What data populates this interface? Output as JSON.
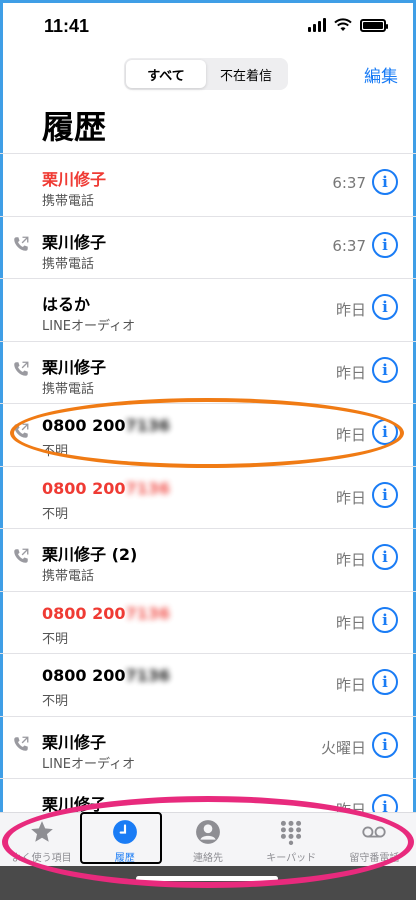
{
  "status_bar": {
    "time": "11:41"
  },
  "segmented": {
    "all": "すべて",
    "missed": "不在着信"
  },
  "header": {
    "edit": "編集",
    "title": "履歴"
  },
  "calls": [
    {
      "name": "栗川修子",
      "name_hidden": "",
      "subtitle": "携帯電話",
      "time": "6:37",
      "missed": true,
      "outgoing": false
    },
    {
      "name": "栗川修子",
      "name_hidden": "",
      "subtitle": "携帯電話",
      "time": "6:37",
      "missed": false,
      "outgoing": true
    },
    {
      "name": "はるか",
      "name_hidden": "",
      "subtitle": "LINEオーディオ",
      "time": "昨日",
      "missed": false,
      "outgoing": false
    },
    {
      "name": "栗川修子",
      "name_hidden": "",
      "subtitle": "携帯電話",
      "time": "昨日",
      "missed": false,
      "outgoing": true
    },
    {
      "name": "0800 200",
      "name_hidden": "7136",
      "subtitle": "不明",
      "time": "昨日",
      "missed": false,
      "outgoing": true
    },
    {
      "name": "0800 200",
      "name_hidden": "7136",
      "subtitle": "不明",
      "time": "昨日",
      "missed": true,
      "outgoing": false
    },
    {
      "name": "栗川修子 (2)",
      "name_hidden": "",
      "subtitle": "携帯電話",
      "time": "昨日",
      "missed": false,
      "outgoing": true
    },
    {
      "name": "0800 200",
      "name_hidden": "7136",
      "subtitle": "不明",
      "time": "昨日",
      "missed": true,
      "outgoing": false
    },
    {
      "name": "0800 200",
      "name_hidden": "7136",
      "subtitle": "不明",
      "time": "昨日",
      "missed": false,
      "outgoing": false
    },
    {
      "name": "栗川修子",
      "name_hidden": "",
      "subtitle": "LINEオーディオ",
      "time": "火曜日",
      "missed": false,
      "outgoing": true
    },
    {
      "name": "栗川修子",
      "name_hidden": "",
      "subtitle": "",
      "time": "昨日",
      "missed": false,
      "outgoing": false
    }
  ],
  "tabs": [
    {
      "label": "よく使う項目",
      "icon": "star-icon"
    },
    {
      "label": "履歴",
      "icon": "clock-icon"
    },
    {
      "label": "連絡先",
      "icon": "person-icon"
    },
    {
      "label": "キーパッド",
      "icon": "keypad-icon"
    },
    {
      "label": "留守番電話",
      "icon": "voicemail-icon"
    }
  ],
  "colors": {
    "accent": "#1a7cf5",
    "missed": "#ef3b34",
    "annotation_orange": "#f07b14",
    "annotation_pink": "#e82a7d"
  }
}
